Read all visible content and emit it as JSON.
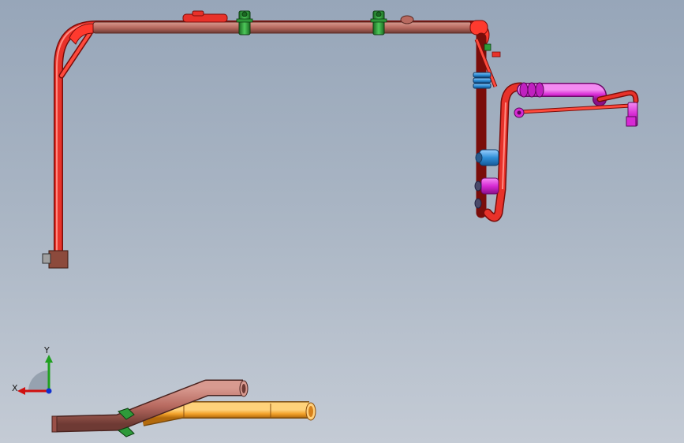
{
  "viewport": {
    "background_top": "#97a6b9",
    "background_bottom": "#c4cbd5"
  },
  "colors": {
    "pipe_red": "#e8322a",
    "pipe_red_dark": "#a81512",
    "pipe_red_light": "#ff8a80",
    "pipe_copper": "#b86a60",
    "pipe_copper_dark": "#6e3a34",
    "pipe_orange": "#f2a12a",
    "pipe_orange_dark": "#b36a0c",
    "clamp_green": "#2e9a3a",
    "fitting_blue": "#2f8fd8",
    "fitting_magenta": "#d72ad4",
    "block_brown": "#8c4a3c"
  },
  "triad": {
    "x_label": "X",
    "y_label": "Y",
    "x_color": "#d01010",
    "y_color": "#20a020",
    "z_color": "#1030d0"
  }
}
